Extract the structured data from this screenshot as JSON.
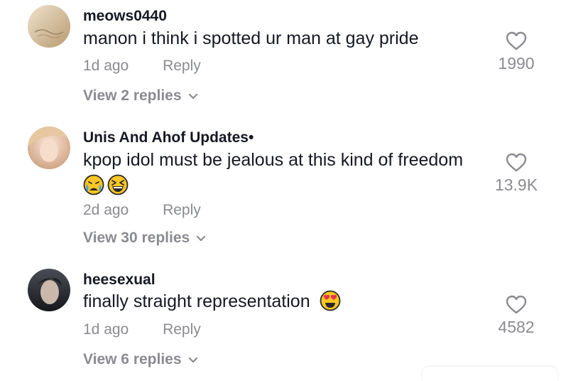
{
  "comments": [
    {
      "username": "meows0440",
      "text": "manon i think i spotted ur man at gay pride",
      "time": "1d ago",
      "reply_label": "Reply",
      "view_replies": "View 2 replies",
      "likes": "1990",
      "avatar_colors": [
        "#e6d6b8",
        "#c7ad86"
      ]
    },
    {
      "username": "Unis And Ahof Updates•",
      "text": "kpop idol must be jealous at this kind of freedom",
      "emojis": [
        "crying-face-emoji",
        "grinning-squinting-face-emoji"
      ],
      "time": "2d ago",
      "reply_label": "Reply",
      "view_replies": "View 30 replies",
      "likes": "13.9K",
      "avatar_colors": [
        "#f3d7c4",
        "#b98a6b"
      ]
    },
    {
      "username": "heesexual",
      "text": "finally straight representation",
      "emojis": [
        "heart-eyes-emoji"
      ],
      "time": "1d ago",
      "reply_label": "Reply",
      "view_replies": "View 6 replies",
      "likes": "4582",
      "avatar_colors": [
        "#6b6e78",
        "#1e2026"
      ]
    }
  ],
  "colors": {
    "text_primary": "#161823",
    "text_secondary": "#8a8b91",
    "emoji_yellow": "#f9c623",
    "emoji_tear": "#3ea0ff",
    "emoji_heart": "#e8324b"
  }
}
